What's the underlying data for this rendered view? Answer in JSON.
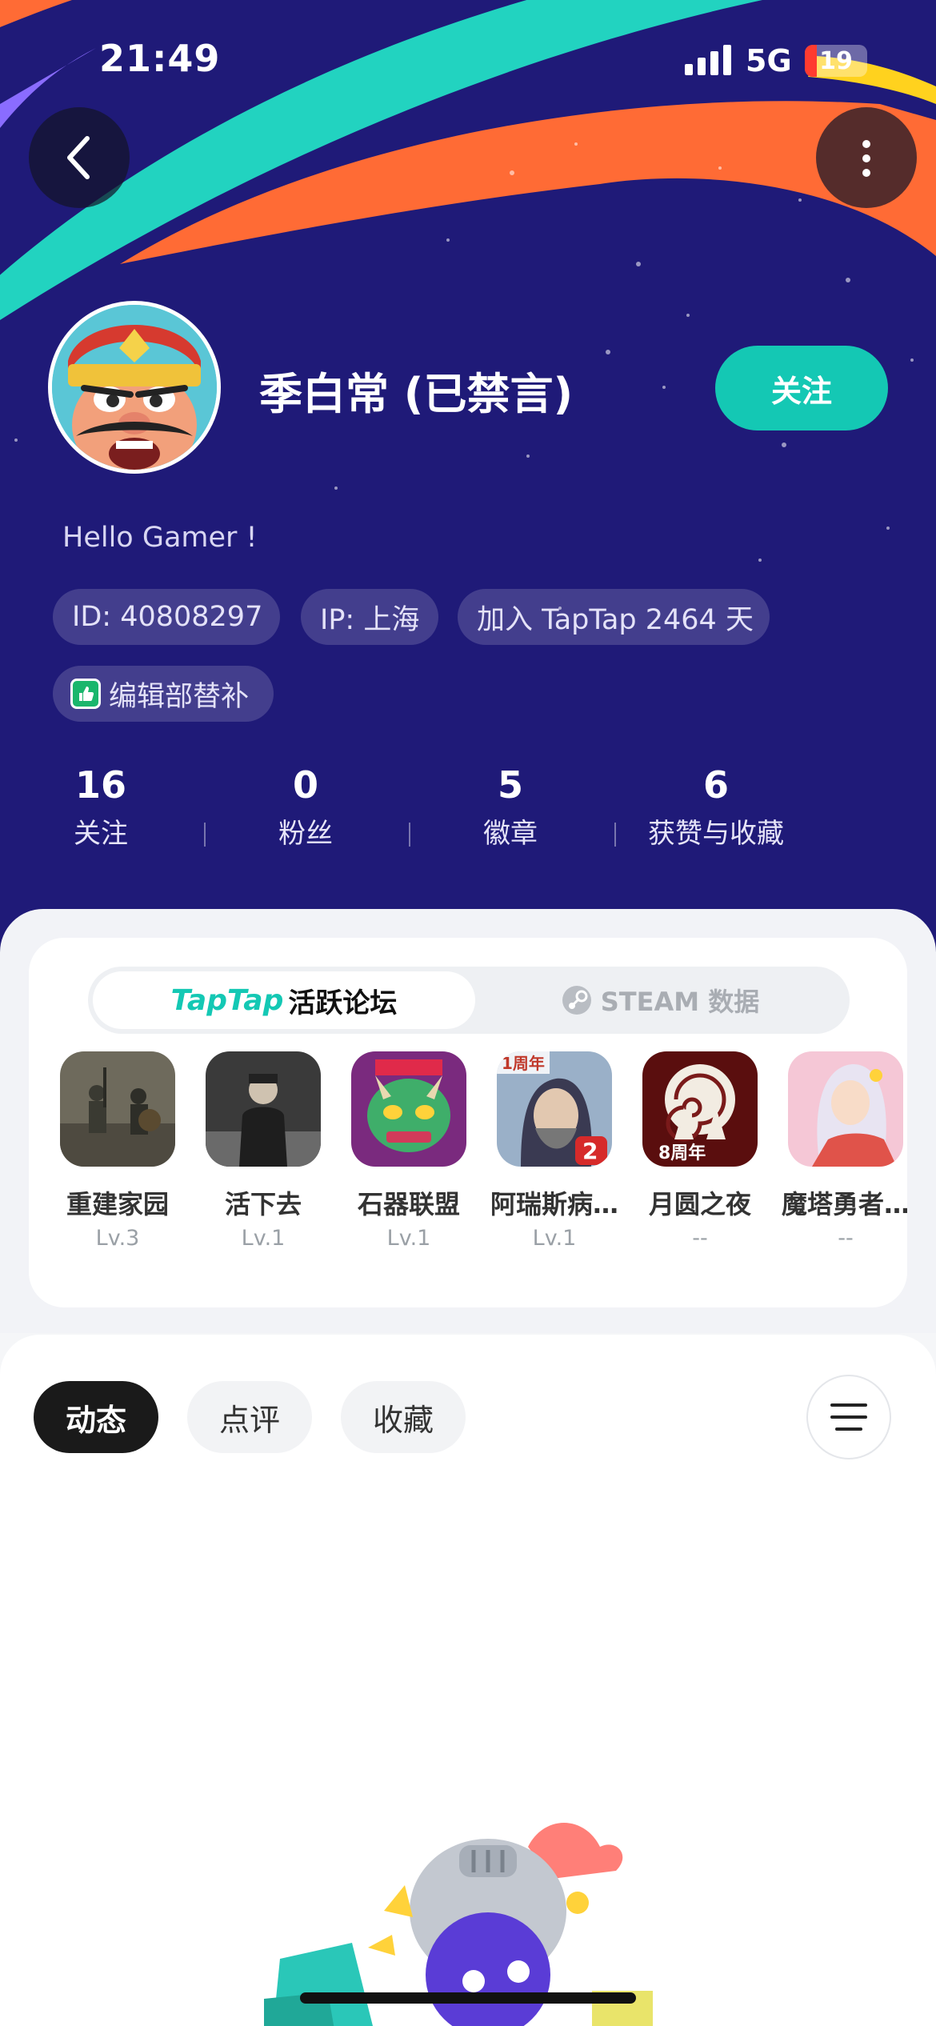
{
  "status_bar": {
    "time": "21:49",
    "network": "5G",
    "battery": "19",
    "battery_level": 0.19
  },
  "header": {
    "back_icon": "chevron-left-icon",
    "more_icon": "vertical-dots-icon"
  },
  "profile": {
    "username": "季白常 (已禁言)",
    "follow_label": "关注",
    "bio": "Hello Gamer !",
    "chips": {
      "id": "ID: 40808297",
      "ip": "IP: 上海",
      "joined": "加入 TapTap 2464 天",
      "badge": "编辑部替补"
    },
    "stats": [
      {
        "value": "16",
        "label": "关注"
      },
      {
        "value": "0",
        "label": "粉丝"
      },
      {
        "value": "5",
        "label": "徽章"
      },
      {
        "value": "6",
        "label": "获赞与收藏"
      }
    ]
  },
  "game_card": {
    "tab_active_brand": "TapTap",
    "tab_active_label": "活跃论坛",
    "tab_inactive_label": "STEAM 数据",
    "games": [
      {
        "name": "重建家园",
        "level": "Lv.3"
      },
      {
        "name": "活下去",
        "level": "Lv.1"
      },
      {
        "name": "石器联盟",
        "level": "Lv.1"
      },
      {
        "name": "阿瑞斯病…",
        "level": "Lv.1",
        "badge": "1周年"
      },
      {
        "name": "月圆之夜",
        "level": "--",
        "badge": "8周年"
      },
      {
        "name": "魔塔勇者…",
        "level": "--"
      }
    ]
  },
  "feed": {
    "tabs": [
      "动态",
      "点评",
      "收藏"
    ],
    "active_tab": "动态",
    "filter_icon": "filter-lines-icon"
  },
  "colors": {
    "hero_bg": "#1f1a78",
    "accent": "#14c8b4",
    "orange": "#ff6b35"
  }
}
